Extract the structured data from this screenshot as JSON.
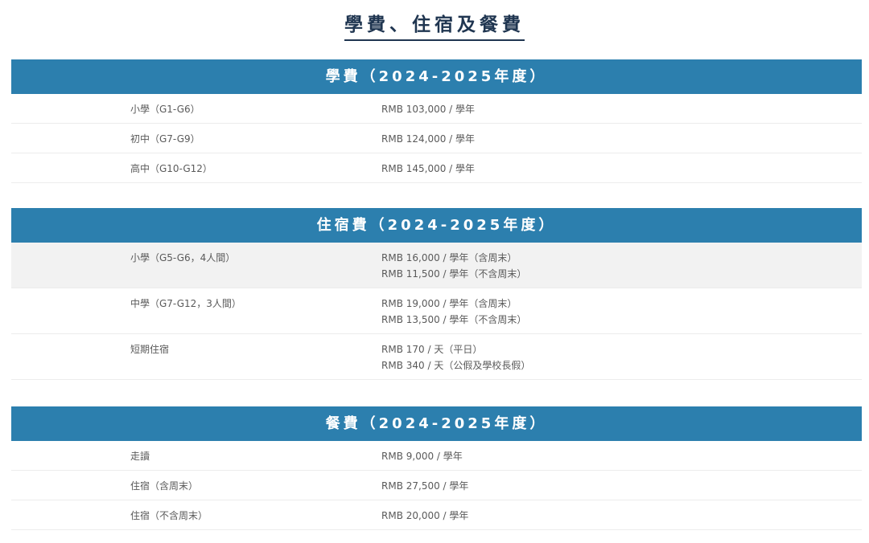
{
  "page_title": "學費、住宿及餐費",
  "tuition": {
    "header": "學費（2024-2025年度）",
    "rows": [
      {
        "label": "小學（G1-G6）",
        "value": "RMB 103,000 / 學年"
      },
      {
        "label": "初中（G7-G9）",
        "value": "RMB 124,000 / 學年"
      },
      {
        "label": "高中（G10-G12）",
        "value": "RMB 145,000 / 學年"
      }
    ]
  },
  "boarding": {
    "header": "住宿費（2024-2025年度）",
    "rows": [
      {
        "label": "小學（G5-G6，4人間）",
        "value_1": "RMB 16,000 / 學年（含周末）",
        "value_2": "RMB 11,500 / 學年（不含周末）"
      },
      {
        "label": "中學（G7-G12，3人間）",
        "value_1": "RMB 19,000 / 學年（含周末）",
        "value_2": "RMB 13,500 / 學年（不含周末）"
      },
      {
        "label": "短期住宿",
        "value_1": "RMB 170 / 天（平日）",
        "value_2": "RMB 340 / 天（公假及學校長假）"
      }
    ]
  },
  "meals": {
    "header": "餐費（2024-2025年度）",
    "rows": [
      {
        "label": "走讀",
        "value": "RMB 9,000 / 學年"
      },
      {
        "label": "住宿（含周末）",
        "value": "RMB 27,500 / 學年"
      },
      {
        "label": "住宿（不含周末）",
        "value": "RMB 20,000 / 學年"
      }
    ]
  },
  "colors": {
    "header_bg": "#2c7fae",
    "title": "#1f3550",
    "shaded_row": "#f2f2f2"
  }
}
